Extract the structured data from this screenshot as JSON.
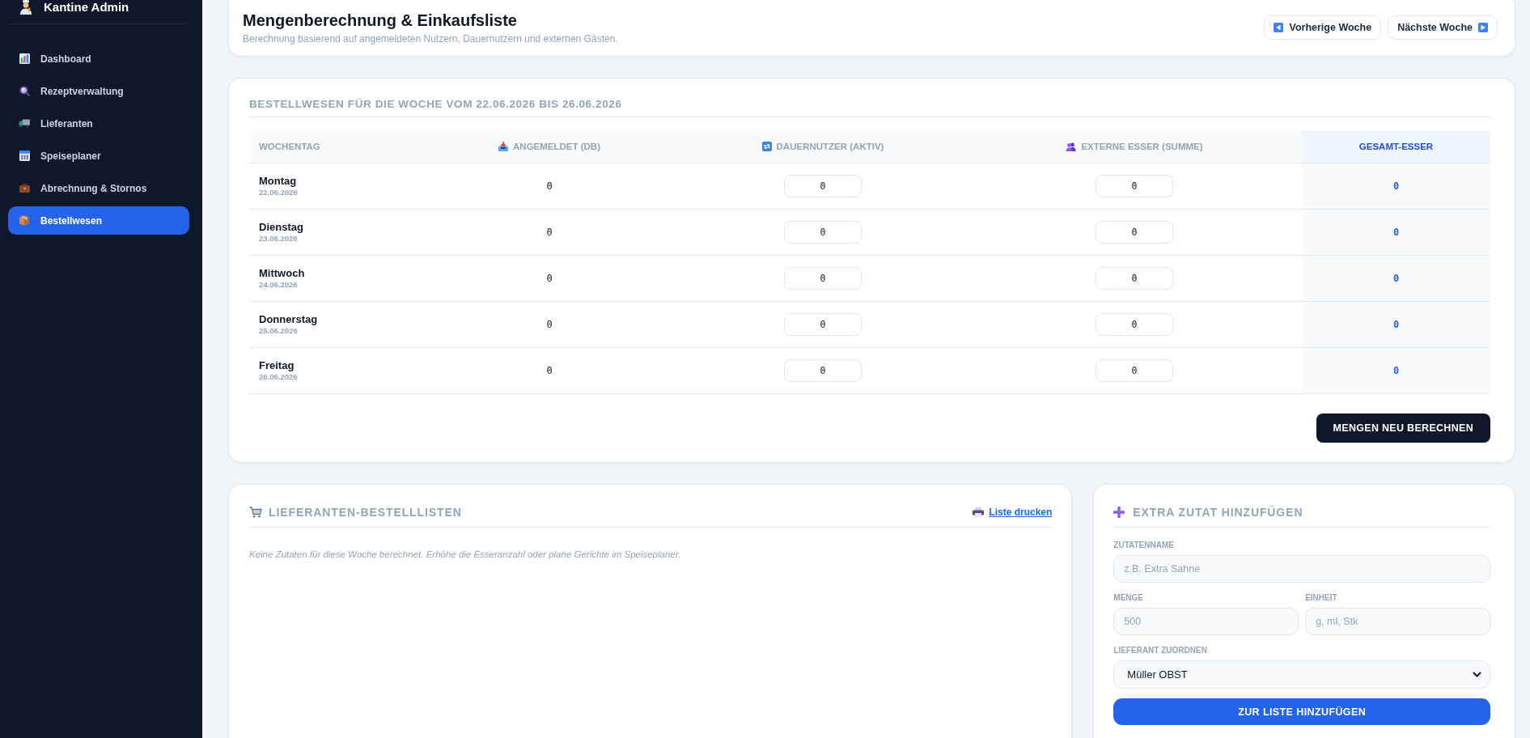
{
  "sidebar": {
    "brand": "Kantine Admin",
    "items": [
      {
        "label": "Dashboard",
        "selected": false
      },
      {
        "label": "Rezeptverwaltung",
        "selected": false
      },
      {
        "label": "Lieferanten",
        "selected": false
      },
      {
        "label": "Speiseplaner",
        "selected": false
      },
      {
        "label": "Abrechnung & Stornos",
        "selected": false
      },
      {
        "label": "Bestellwesen",
        "selected": true
      }
    ]
  },
  "header": {
    "title": "Mengenberechnung & Einkaufsliste",
    "subtitle": "Berechnung basierend auf angemeldeten Nutzern, Dauernutzern und externen Gästen.",
    "buttons": [
      {
        "label": "Vorherige Woche",
        "kind": "prev"
      },
      {
        "label": "Nächste Woche",
        "kind": "next"
      }
    ]
  },
  "order": {
    "title": "BESTELLWESEN FÜR DIE WOCHE VOM 22.06.2026 BIS 26.06.2026",
    "columns": [
      {
        "label": "WOCHENTAG",
        "kind": "day"
      },
      {
        "label": "ANGEMELDET (DB)",
        "kind": "count"
      },
      {
        "label": "DAUERNUTZER (AKTIV)",
        "kind": "input"
      },
      {
        "label": "EXTERNE ESSER (SUMME)",
        "kind": "input"
      },
      {
        "label": "GESAMT-ESSER",
        "kind": "total"
      }
    ],
    "rows": [
      {
        "day": "Montag",
        "date": "22.06.2026",
        "values": [
          "0",
          "0",
          "0",
          "0"
        ]
      },
      {
        "day": "Dienstag",
        "date": "23.06.2026",
        "values": [
          "0",
          "0",
          "0",
          "0"
        ]
      },
      {
        "day": "Mittwoch",
        "date": "24.06.2026",
        "values": [
          "0",
          "0",
          "0",
          "0"
        ]
      },
      {
        "day": "Donnerstag",
        "date": "25.06.2026",
        "values": [
          "0",
          "0",
          "0",
          "0"
        ]
      },
      {
        "day": "Freitag",
        "date": "26.06.2026",
        "values": [
          "0",
          "0",
          "0",
          "0"
        ]
      }
    ],
    "button": "MENGEN NEU BERECHNEN"
  },
  "suppliers": {
    "title": "LIEFERANTEN-BESTELLLISTEN",
    "link": "Liste drucken",
    "empty_message": "Keine Zutaten für diese Woche berechnet. Erhöhe die Esseranzahl oder plane Gerichte im Speiseplaner."
  },
  "extra": {
    "title": "EXTRA ZUTAT HINZUFÜGEN",
    "field_rows": [
      [
        {
          "label": "ZUTATENNAME",
          "kind": "text",
          "placeholder": "z.B. Extra Sahne"
        }
      ],
      [
        {
          "label": "MENGE",
          "kind": "text",
          "placeholder": "500"
        },
        {
          "label": "EINHEIT",
          "kind": "text",
          "placeholder": "g, ml, Stk"
        }
      ],
      [
        {
          "label": "LIEFERANT ZUORDNEN",
          "kind": "select",
          "value": "Müller OBST"
        }
      ]
    ],
    "button": "ZUR LISTE HINZUFÜGEN"
  }
}
